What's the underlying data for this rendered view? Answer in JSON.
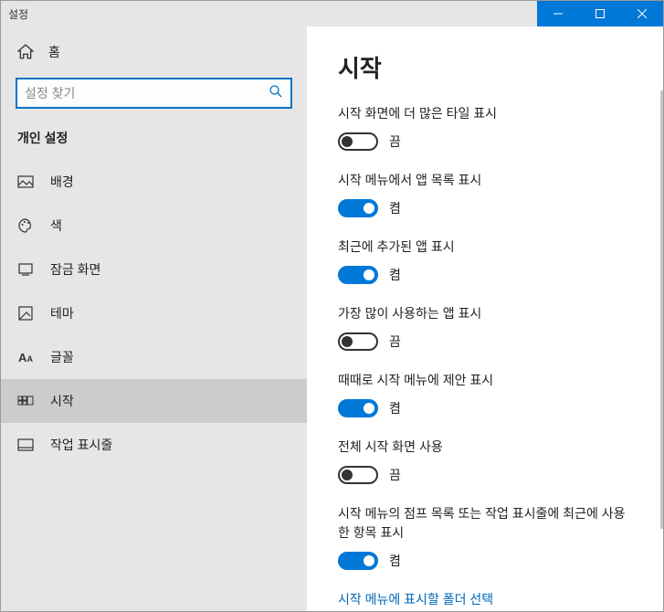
{
  "window": {
    "title": "설정"
  },
  "sidebar": {
    "home": "홈",
    "search_placeholder": "설정 찾기",
    "section": "개인 설정",
    "items": [
      {
        "label": "배경"
      },
      {
        "label": "색"
      },
      {
        "label": "잠금 화면"
      },
      {
        "label": "테마"
      },
      {
        "label": "글꼴"
      },
      {
        "label": "시작"
      },
      {
        "label": "작업 표시줄"
      }
    ]
  },
  "page": {
    "title": "시작",
    "settings": [
      {
        "label": "시작 화면에 더 많은 타일 표시",
        "on": false
      },
      {
        "label": "시작 메뉴에서 앱 목록 표시",
        "on": true
      },
      {
        "label": "최근에 추가된 앱 표시",
        "on": true
      },
      {
        "label": "가장 많이 사용하는 앱 표시",
        "on": false
      },
      {
        "label": "때때로 시작 메뉴에 제안 표시",
        "on": true
      },
      {
        "label": "전체 시작 화면 사용",
        "on": false
      },
      {
        "label": "시작 메뉴의 점프 목록 또는 작업 표시줄에 최근에 사용한 항목 표시",
        "on": true
      }
    ],
    "state_on": "켬",
    "state_off": "끔",
    "link": "시작 메뉴에 표시할 폴더 선택"
  }
}
